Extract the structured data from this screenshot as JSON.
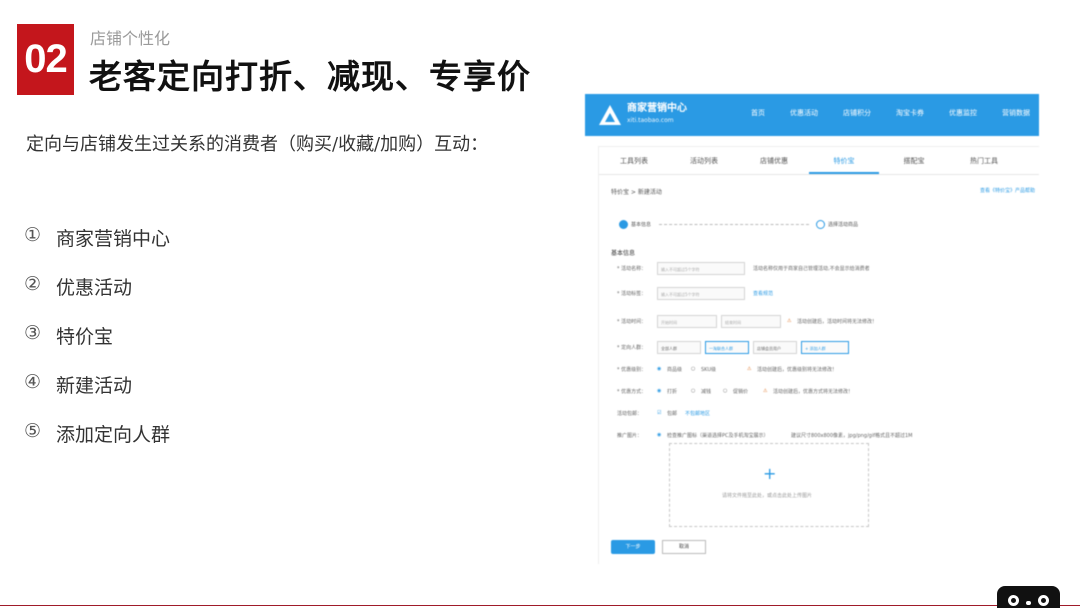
{
  "slide": {
    "number": "02",
    "subtitle": "店铺个性化",
    "title": "老客定向打折、减现、专享价",
    "description": "定向与店铺发生过关系的消费者（购买/收藏/加购）互动：",
    "steps": [
      {
        "marker": "①",
        "label": "商家营销中心"
      },
      {
        "marker": "②",
        "label": "优惠活动"
      },
      {
        "marker": "③",
        "label": "特价宝"
      },
      {
        "marker": "④",
        "label": "新建活动"
      },
      {
        "marker": "⑤",
        "label": "添加定向人群"
      }
    ]
  },
  "screenshot": {
    "brand": "商家营销中心",
    "brand_url": "xiti.taobao.com",
    "nav": [
      "首页",
      "优惠活动",
      "店铺积分",
      "淘宝卡券",
      "优惠监控",
      "营销数据"
    ],
    "tabs": [
      "工具列表",
      "活动列表",
      "店铺优惠",
      "特价宝",
      "搭配宝",
      "热门工具"
    ],
    "active_tab_index": 3,
    "breadcrumb": "特价宝 > 新建活动",
    "help_link": "查看《特价宝》产品帮助",
    "progress": {
      "step1": "基本信息",
      "step2": "选择活动商品"
    },
    "section_title": "基本信息",
    "fields": {
      "name_label": "* 活动名称：",
      "name_placeholder": "输入不可超过5个字符",
      "name_note": "活动名称仅用于商家自己管理活动,不会显示给消费者",
      "tag_label": "* 活动标签：",
      "tag_placeholder": "输入不可超过5个字符",
      "tag_note": "查看规范",
      "time_label": "* 活动时间：",
      "start_placeholder": "开始时间",
      "end_placeholder": "结束时间",
      "time_note": "活动创建后，活动时间将无法修改！",
      "crowd_label": "* 定向人群：",
      "crowd_options": [
        "全部人群",
        "一淘联合人群",
        "店铺会员用户",
        "+ 添加人群"
      ],
      "level_label": "* 优惠级别：",
      "level_options": [
        "商品级",
        "SKU级"
      ],
      "level_note": "活动创建后，优惠级别将无法修改！",
      "type_label": "* 优惠方式：",
      "type_options": [
        "打折",
        "减钱",
        "促销价"
      ],
      "type_note": "活动创建后，优惠方式将无法修改！",
      "limit_label": "活动包邮：",
      "limit_value": "包邮",
      "limit_link": "不包邮地区",
      "image_label": "推广图片：",
      "image_note": "检查推广图标（渠道选择PC及手机淘宝展示）",
      "image_spec": "建议尺寸800x800像素，jpg/png/gif格式且不超过1M",
      "upload_hint": "请将文件拖至此处，或点击此处上传图片"
    },
    "buttons": {
      "next": "下一步",
      "cancel": "取消"
    }
  },
  "colors": {
    "accent_red": "#c4161c",
    "nav_blue": "#2a9ae4"
  }
}
